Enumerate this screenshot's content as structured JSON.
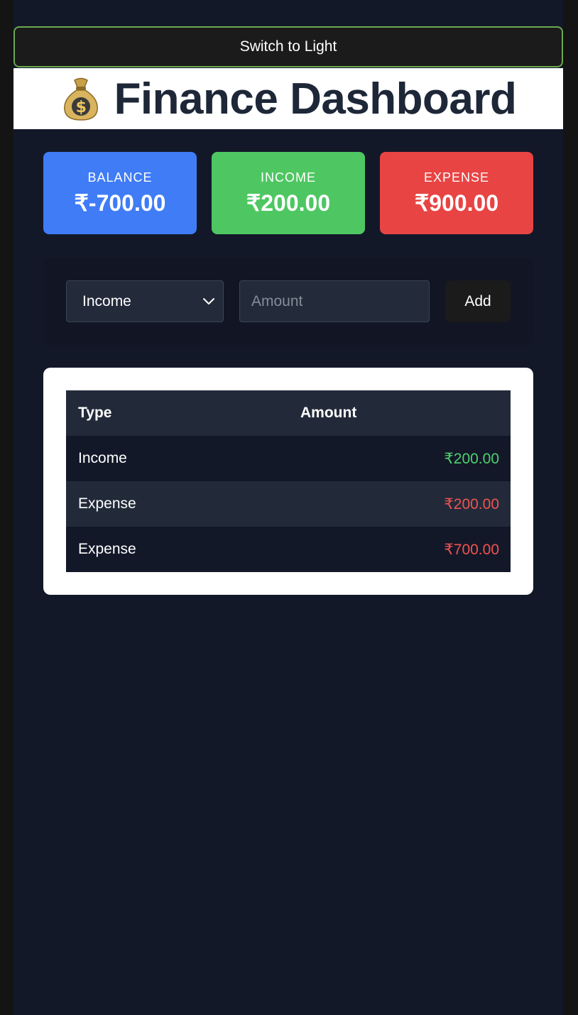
{
  "toggle": {
    "label": "Switch to Light"
  },
  "header": {
    "title": "Finance Dashboard",
    "icon": "money-bag-icon"
  },
  "summary": {
    "balance": {
      "label": "BALANCE",
      "value": "₹-700.00",
      "color": "#3f7cf6"
    },
    "income": {
      "label": "INCOME",
      "value": "₹200.00",
      "color": "#4ec762"
    },
    "expense": {
      "label": "EXPENSE",
      "value": "₹900.00",
      "color": "#e84444"
    }
  },
  "form": {
    "type_select": {
      "selected": "Income",
      "options": [
        "Income"
      ]
    },
    "amount_input": {
      "placeholder": "Amount",
      "value": ""
    },
    "add_label": "Add"
  },
  "table": {
    "headers": {
      "type": "Type",
      "amount": "Amount"
    },
    "rows": [
      {
        "type": "Income",
        "amount": "₹200.00"
      },
      {
        "type": "Expense",
        "amount": "₹200.00"
      },
      {
        "type": "Expense",
        "amount": "₹700.00"
      }
    ]
  },
  "colors": {
    "income_text": "#4ed16c",
    "expense_text": "#ef5350",
    "toggle_border": "#6aa84f"
  }
}
